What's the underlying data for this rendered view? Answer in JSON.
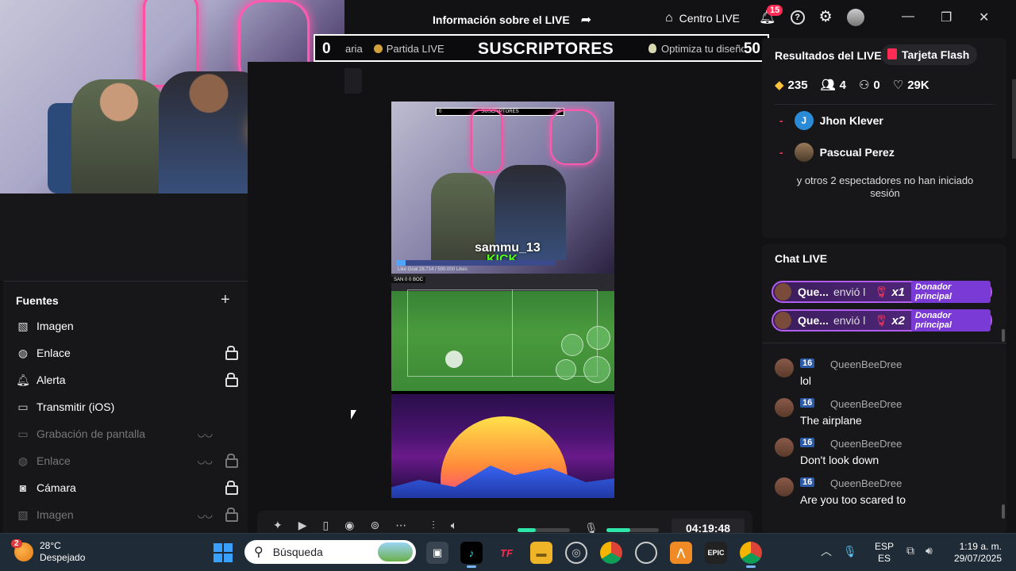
{
  "titlebar": {
    "title": "Información sobre el LIVE",
    "centro": "Centro LIVE",
    "notif_count": "15"
  },
  "banner": {
    "left_value": "0",
    "right_value": "50",
    "ticker_left_1": "aria",
    "ticker_left_2": "Partida LIVE",
    "main_label": "SUSCRIPTORES",
    "ticker_right": "Optimiza tu diseño"
  },
  "preview": {
    "mini_banner_label": "SUSCRIPTORES",
    "mini_left": "0",
    "mini_right": "50",
    "streamer_name": "sammu_13",
    "platform": "KICK",
    "like_goal_text": "Like Goal 28,714 / 500.000 Likes",
    "like_goal_progress": 0.06,
    "game_score": "SAN 0 0 BOC"
  },
  "sources": {
    "title": "Fuentes",
    "items": [
      {
        "label": "Imagen",
        "icon": "image-icon",
        "lock": false,
        "hidden": false
      },
      {
        "label": "Enlace",
        "icon": "globe-icon",
        "lock": true,
        "hidden": false
      },
      {
        "label": "Alerta",
        "icon": "bell-icon",
        "lock": true,
        "hidden": false
      },
      {
        "label": "Transmitir (iOS)",
        "icon": "monitor-icon",
        "lock": false,
        "hidden": false
      },
      {
        "label": "Grabación de pantalla",
        "icon": "monitor-icon",
        "lock": false,
        "hidden": true
      },
      {
        "label": "Enlace",
        "icon": "globe-icon",
        "lock": true,
        "hidden": true
      },
      {
        "label": "Cámara",
        "icon": "camera-icon",
        "lock": true,
        "hidden": false
      },
      {
        "label": "Imagen",
        "icon": "image-icon",
        "lock": true,
        "hidden": true
      }
    ]
  },
  "toolbar": {
    "timer": "04:19:48",
    "volume_level": 0.35,
    "mic_level": 0.45
  },
  "results": {
    "title": "Resultados del LIVE",
    "chip": "Tarjeta Flash",
    "diamonds": "235",
    "viewers": "4",
    "followers": "0",
    "likes": "29K",
    "viewers_list": [
      {
        "initial": "J",
        "name": "Jhon Klever"
      },
      {
        "initial": "",
        "name": "Pascual Perez"
      }
    ],
    "others_text": "y otros 2 espectadores no han iniciado sesión"
  },
  "chat": {
    "title": "Chat LIVE",
    "gifts": [
      {
        "name": "Que...",
        "msg": "envió l",
        "mult": "x1",
        "tag": "Donador principal"
      },
      {
        "name": "Que...",
        "msg": "envió l",
        "mult": "x2",
        "tag": "Donador principal"
      }
    ],
    "messages": [
      {
        "level": "16",
        "user": "QueenBeeDree",
        "text": "lol"
      },
      {
        "level": "16",
        "user": "QueenBeeDree",
        "text": "The airplane"
      },
      {
        "level": "16",
        "user": "QueenBeeDree",
        "text": "Don't look down"
      },
      {
        "level": "16",
        "user": "QueenBeeDree",
        "text": "Are you too scared to"
      }
    ]
  },
  "taskbar": {
    "weather_badge": "2",
    "temp": "28°C",
    "condition": "Despejado",
    "search_placeholder": "Búsqueda",
    "lang_top": "ESP",
    "lang_bottom": "ES",
    "time": "1:19 a. m.",
    "date": "29/07/2025"
  },
  "colors": {
    "accent": "#fe2c55",
    "kick_green": "#53fc18",
    "gift_border": "#b25cf0",
    "level_badge": "#2a5aa8"
  }
}
